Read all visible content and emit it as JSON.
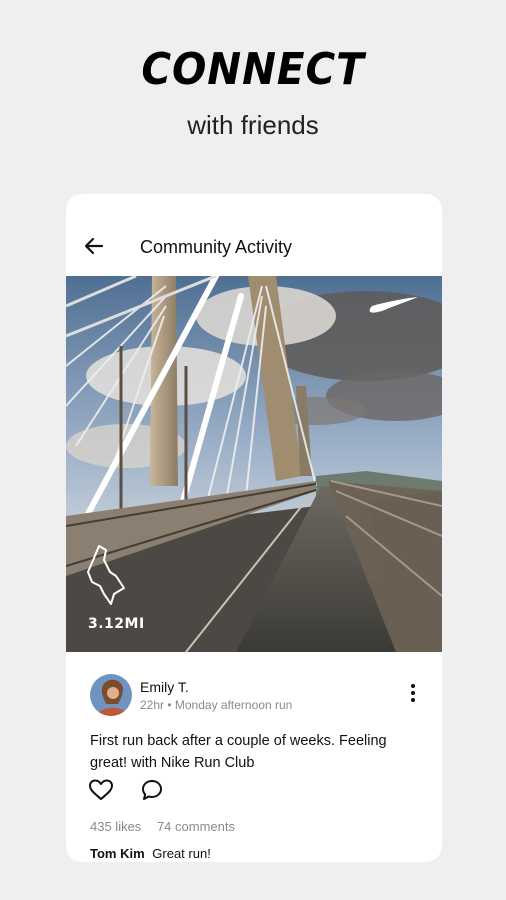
{
  "hero": {
    "title": "CONNECT",
    "subtitle": "with friends"
  },
  "topbar": {
    "title": "Community Activity",
    "back_icon": "arrow-left-icon"
  },
  "activity": {
    "distance": "3.12MI",
    "brand_icon": "swoosh-logo"
  },
  "post": {
    "author": "Emily T.",
    "meta": "22hr • Monday afternoon run",
    "text": "First run back after a couple of weeks. Feeling great! with Nike Run Club",
    "likes": "435 likes",
    "comments": "74 comments",
    "top_comment": {
      "user": "Tom Kim",
      "text": "Great run!"
    }
  },
  "colors": {
    "background": "#efefef",
    "card": "#ffffff",
    "muted_text": "#8a8a8a"
  }
}
